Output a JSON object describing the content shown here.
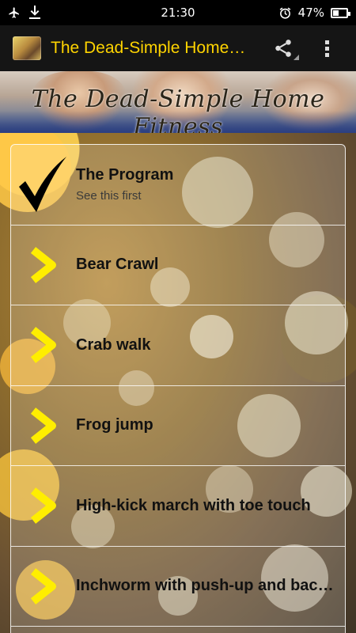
{
  "status_bar": {
    "time": "21:30",
    "battery_percent": "47%",
    "battery_level": 0.47,
    "icons": [
      "airplane-icon",
      "download-icon",
      "alarm-icon",
      "battery-icon"
    ]
  },
  "app_bar": {
    "title": "The Dead-Simple Home Fitness",
    "actions": [
      "share-icon",
      "more-vert-icon"
    ],
    "accent_color": "#ffd400"
  },
  "banner": {
    "title": "The Dead-Simple Home Fitness"
  },
  "list": {
    "items": [
      {
        "icon": "checkmark-icon",
        "title": "The Program",
        "subtitle": "See this first"
      },
      {
        "icon": "chevron-right-icon",
        "title": "Bear Crawl"
      },
      {
        "icon": "chevron-right-icon",
        "title": "Crab walk"
      },
      {
        "icon": "chevron-right-icon",
        "title": "Frog jump"
      },
      {
        "icon": "chevron-right-icon",
        "title": "High-kick march with toe touch"
      },
      {
        "icon": "chevron-right-icon",
        "title": "Inchworm with push-up and back extension"
      }
    ],
    "chevron_color": "#ffee00"
  }
}
